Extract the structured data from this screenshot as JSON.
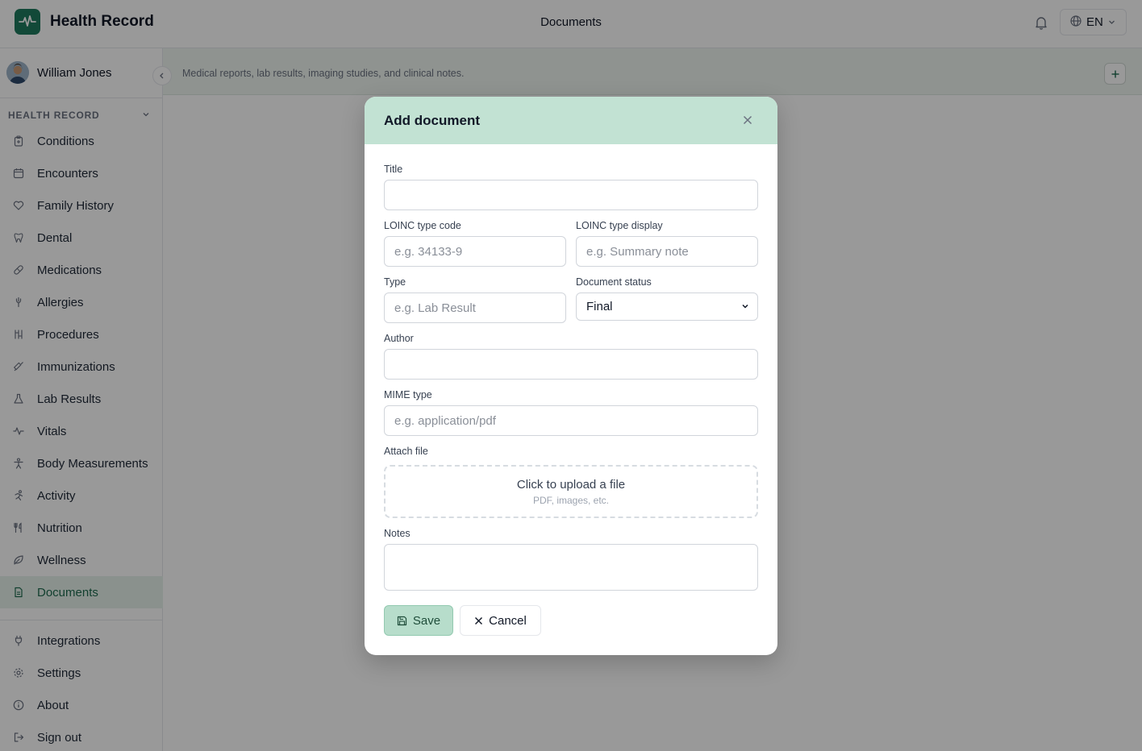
{
  "app": {
    "name": "Health Record",
    "page_title": "Documents",
    "language": "EN"
  },
  "user": {
    "name": "William Jones"
  },
  "sidebar": {
    "section_label": "HEALTH RECORD",
    "items": [
      {
        "label": "Conditions",
        "icon": "clipboard-icon",
        "active": false
      },
      {
        "label": "Encounters",
        "icon": "calendar-icon",
        "active": false
      },
      {
        "label": "Family History",
        "icon": "heart-icon",
        "active": false
      },
      {
        "label": "Dental",
        "icon": "tooth-icon",
        "active": false
      },
      {
        "label": "Medications",
        "icon": "pill-icon",
        "active": false
      },
      {
        "label": "Allergies",
        "icon": "allergy-icon",
        "active": false
      },
      {
        "label": "Procedures",
        "icon": "procedures-icon",
        "active": false
      },
      {
        "label": "Immunizations",
        "icon": "syringe-icon",
        "active": false
      },
      {
        "label": "Lab Results",
        "icon": "flask-icon",
        "active": false
      },
      {
        "label": "Vitals",
        "icon": "pulse-icon",
        "active": false
      },
      {
        "label": "Body Measurements",
        "icon": "body-icon",
        "active": false
      },
      {
        "label": "Activity",
        "icon": "run-icon",
        "active": false
      },
      {
        "label": "Nutrition",
        "icon": "utensils-icon",
        "active": false
      },
      {
        "label": "Wellness",
        "icon": "leaf-icon",
        "active": false
      },
      {
        "label": "Documents",
        "icon": "document-icon",
        "active": true
      }
    ],
    "bottom_items": [
      {
        "label": "Integrations",
        "icon": "plug-icon"
      },
      {
        "label": "Settings",
        "icon": "gear-icon"
      },
      {
        "label": "About",
        "icon": "info-icon"
      },
      {
        "label": "Sign out",
        "icon": "sign-out-icon"
      }
    ]
  },
  "page": {
    "description": "Medical reports, lab results, imaging studies, and clinical notes."
  },
  "modal": {
    "title": "Add document",
    "fields": {
      "title": {
        "label": "Title",
        "value": "",
        "placeholder": ""
      },
      "loinc_code": {
        "label": "LOINC type code",
        "value": "",
        "placeholder": "e.g. 34133-9"
      },
      "loinc_display": {
        "label": "LOINC type display",
        "value": "",
        "placeholder": "e.g. Summary note"
      },
      "type": {
        "label": "Type",
        "value": "",
        "placeholder": "e.g. Lab Result"
      },
      "status": {
        "label": "Document status",
        "value": "Final"
      },
      "author": {
        "label": "Author",
        "value": "",
        "placeholder": ""
      },
      "mime": {
        "label": "MIME type",
        "value": "",
        "placeholder": "e.g. application/pdf"
      },
      "attach": {
        "label": "Attach file",
        "upload_text": "Click to upload a file",
        "upload_hint": "PDF, images, etc."
      },
      "notes": {
        "label": "Notes",
        "value": ""
      }
    },
    "save_label": "Save",
    "cancel_label": "Cancel"
  },
  "colors": {
    "brand": "#1f7a5e",
    "modal_header": "#c2e2d3",
    "active_nav": "#e7f2ec",
    "save_button": "#b7ddcb"
  }
}
